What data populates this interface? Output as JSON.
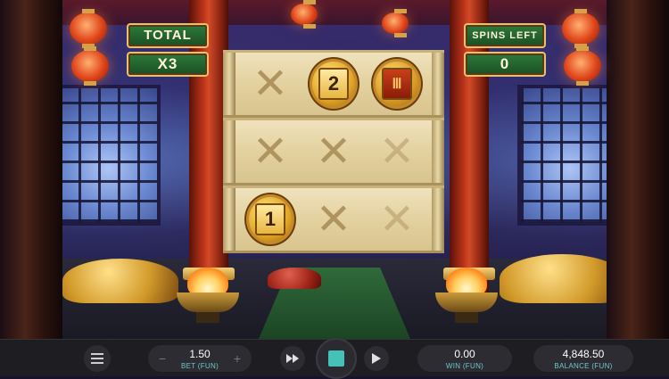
{
  "game": {
    "total_sign": {
      "label": "TOTAL",
      "value": "X3"
    },
    "spins_sign": {
      "label": "SPINS LEFT",
      "value": "0"
    },
    "board": {
      "rows": [
        [
          {
            "type": "x"
          },
          {
            "type": "coin",
            "value": "2"
          },
          {
            "type": "coin-blank",
            "value": "Ⅲ"
          }
        ],
        [
          {
            "type": "x"
          },
          {
            "type": "x"
          },
          {
            "type": "x-faded"
          }
        ],
        [
          {
            "type": "coin",
            "value": "1"
          },
          {
            "type": "x"
          },
          {
            "type": "x-faded"
          }
        ]
      ]
    }
  },
  "controls": {
    "menu_icon": "hamburger-icon",
    "bet": {
      "value": "1.50",
      "label": "BET (FUN)",
      "decrease": "−",
      "increase": "+"
    },
    "fast_forward_icon": "fast-forward-icon",
    "spin_stop_icon": "stop-square-icon",
    "autoplay_icon": "play-icon",
    "win": {
      "value": "0.00",
      "label": "WIN (FUN)"
    },
    "balance": {
      "value": "4,848.50",
      "label": "BALANCE (FUN)"
    },
    "accent_color": "#6fc8c4",
    "stop_color": "#44c2b8"
  }
}
